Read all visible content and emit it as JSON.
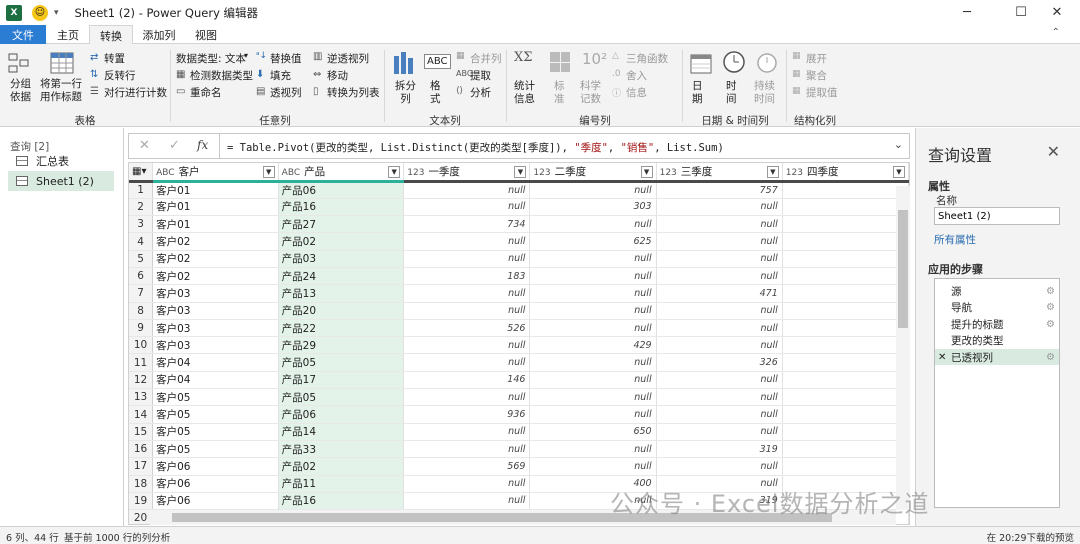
{
  "window": {
    "title": "Sheet1 (2) - Power Query 编辑器",
    "minimize": "─",
    "maximize": "☐",
    "close": "✕"
  },
  "tabs": [
    "文件",
    "主页",
    "转换",
    "添加列",
    "视图"
  ],
  "ribbon": {
    "groups": {
      "table": "表格",
      "anycol": "任意列",
      "textcol": "文本列",
      "numcol": "编号列",
      "datetime": "日期 & 时间列",
      "struct": "结构化列"
    },
    "table": {
      "group_by": "分组\n依据",
      "use_first_row": "将第一行\n用作标题",
      "transpose": "转置",
      "reverse": "反转行",
      "count_rows": "对行进行计数"
    },
    "anycol": {
      "data_type": "数据类型: 文本",
      "detect": "检测数据类型",
      "rename": "重命名",
      "replace": "替换值",
      "fill": "填充",
      "pivot": "透视列",
      "unpivot": "逆透视列",
      "move": "移动",
      "to_list": "转换为列表"
    },
    "textcol": {
      "split": "拆分\n列",
      "format": "格\n式",
      "merge": "合并列",
      "extract": "提取",
      "parse": "分析"
    },
    "numcol": {
      "stats": "统计\n信息",
      "std": "标\n准",
      "sci": "科学\n记数",
      "trig": "三角函数",
      "round": "舍入",
      "info": "信息"
    },
    "datetime": {
      "date": "日\n期",
      "time": "时\n间",
      "duration": "持续\n时间"
    },
    "struct": {
      "expand": "展开",
      "aggregate": "聚合",
      "extract_values": "提取值"
    }
  },
  "queries": {
    "header": "查询 [2]",
    "items": [
      {
        "label": "汇总表"
      },
      {
        "label": "Sheet1 (2)"
      }
    ]
  },
  "formula": {
    "cancel": "✕",
    "confirm": "✓",
    "fx": "fx",
    "prefix": "= Table.Pivot(更改的类型, List.Distinct(更改的类型[季度]), ",
    "s1": "\"季度\"",
    "mid": ", ",
    "s2": "\"销售\"",
    "suffix": ", List.Sum)"
  },
  "columns": [
    {
      "type": "ABC",
      "name": "客户"
    },
    {
      "type": "ABC",
      "name": "产品"
    },
    {
      "type": "123",
      "name": "一季度"
    },
    {
      "type": "123",
      "name": "二季度"
    },
    {
      "type": "123",
      "name": "三季度"
    },
    {
      "type": "123",
      "name": "四季度"
    }
  ],
  "rows": [
    [
      "1",
      "客户01",
      "产品06",
      "null",
      "null",
      "757"
    ],
    [
      "2",
      "客户01",
      "产品16",
      "null",
      "303",
      "null"
    ],
    [
      "3",
      "客户01",
      "产品27",
      "734",
      "null",
      "null"
    ],
    [
      "4",
      "客户02",
      "产品02",
      "null",
      "625",
      "null"
    ],
    [
      "5",
      "客户02",
      "产品03",
      "null",
      "null",
      "null"
    ],
    [
      "6",
      "客户02",
      "产品24",
      "183",
      "null",
      "null"
    ],
    [
      "7",
      "客户03",
      "产品13",
      "null",
      "null",
      "471"
    ],
    [
      "8",
      "客户03",
      "产品20",
      "null",
      "null",
      "null"
    ],
    [
      "9",
      "客户03",
      "产品22",
      "526",
      "null",
      "null"
    ],
    [
      "10",
      "客户03",
      "产品29",
      "null",
      "429",
      "null"
    ],
    [
      "11",
      "客户04",
      "产品05",
      "null",
      "null",
      "326"
    ],
    [
      "12",
      "客户04",
      "产品17",
      "146",
      "null",
      "null"
    ],
    [
      "13",
      "客户05",
      "产品05",
      "null",
      "null",
      "null"
    ],
    [
      "14",
      "客户05",
      "产品06",
      "936",
      "null",
      "null"
    ],
    [
      "15",
      "客户05",
      "产品14",
      "null",
      "650",
      "null"
    ],
    [
      "16",
      "客户05",
      "产品33",
      "null",
      "null",
      "319"
    ],
    [
      "17",
      "客户06",
      "产品02",
      "569",
      "null",
      "null"
    ],
    [
      "18",
      "客户06",
      "产品11",
      "null",
      "400",
      "null"
    ],
    [
      "19",
      "客户06",
      "产品16",
      "null",
      "null",
      "319"
    ],
    [
      "20",
      "",
      "",
      "",
      "",
      ""
    ]
  ],
  "settings": {
    "title": "查询设置",
    "properties": "属性",
    "name_label": "名称",
    "name_value": "Sheet1 (2)",
    "all_props": "所有属性",
    "steps_header": "应用的步骤",
    "steps": [
      {
        "label": "源"
      },
      {
        "label": "导航"
      },
      {
        "label": "提升的标题"
      },
      {
        "label": "更改的类型"
      },
      {
        "label": "已透视列"
      }
    ]
  },
  "status": {
    "cols": "6 列、44 行",
    "profile": "基于前 1000 行的列分析",
    "download": "在 20:29下载的预览"
  },
  "watermark": "公众号 · Excel数据分析之道"
}
